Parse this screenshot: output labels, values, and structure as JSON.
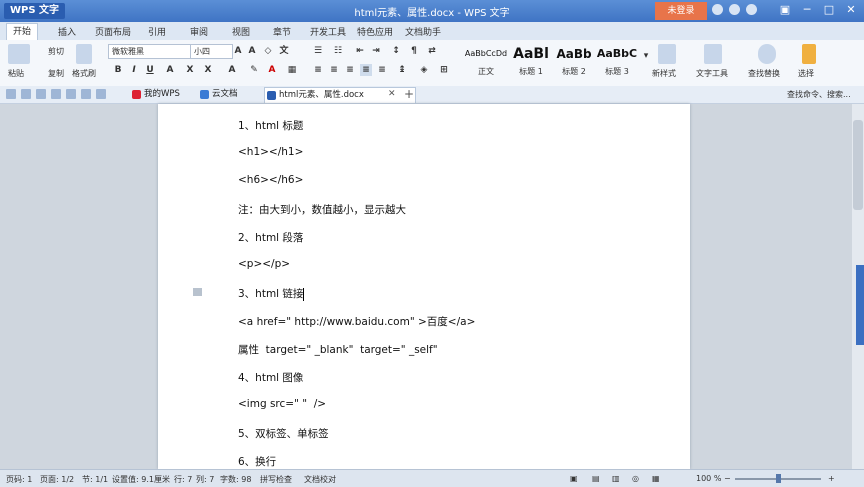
{
  "app": {
    "logo": "WPS 文字",
    "window_title": "html元素、属性.docx - WPS 文字",
    "login": "未登录"
  },
  "menu": [
    "开始",
    "插入",
    "页面布局",
    "引用",
    "审阅",
    "视图",
    "章节",
    "开发工具",
    "特色应用",
    "文档助手"
  ],
  "ribbon": {
    "paste": "粘贴",
    "cut": "剪切",
    "copy": "复制",
    "format_painter": "格式刷",
    "font_name": "微软雅黑",
    "font_size": "小四",
    "styles": [
      {
        "sample": "AaBbCcDd",
        "name": "正文"
      },
      {
        "sample": "AaBl",
        "name": "标题 1"
      },
      {
        "sample": "AaBb",
        "name": "标题 2"
      },
      {
        "sample": "AaBbC",
        "name": "标题 3"
      }
    ],
    "new_style": "新样式",
    "text_tools": "文字工具",
    "find_replace": "查找替换",
    "select": "选择"
  },
  "tabs": {
    "my_wps": "我的WPS",
    "cloud": "云文档",
    "document": "html元素、属性.docx",
    "search_cmd": "查找命令、搜索..."
  },
  "document": {
    "lines": [
      "1、html 标题",
      "<h1></h1>",
      "<h6></h6>",
      "注：由大到小，数值越小，显示越大",
      "2、html 段落",
      "<p></p>",
      "3、html 链接",
      "<a href=\" http://www.baidu.com\" >百度</a>",
      "属性  target=\" _blank\"  target=\" _self\"",
      "4、html 图像",
      "<img src=\" \"  />",
      "5、双标签、单标签",
      "6、换行"
    ]
  },
  "status": {
    "page": "页码: 1",
    "pages": "页面: 1/2",
    "section": "节: 1/1",
    "position": "设置值: 9.1厘米",
    "row": "行: 7",
    "col": "列: 7",
    "words": "字数: 98",
    "spell": "拼写检查",
    "proof": "文档校对",
    "zoom": "100 %"
  }
}
